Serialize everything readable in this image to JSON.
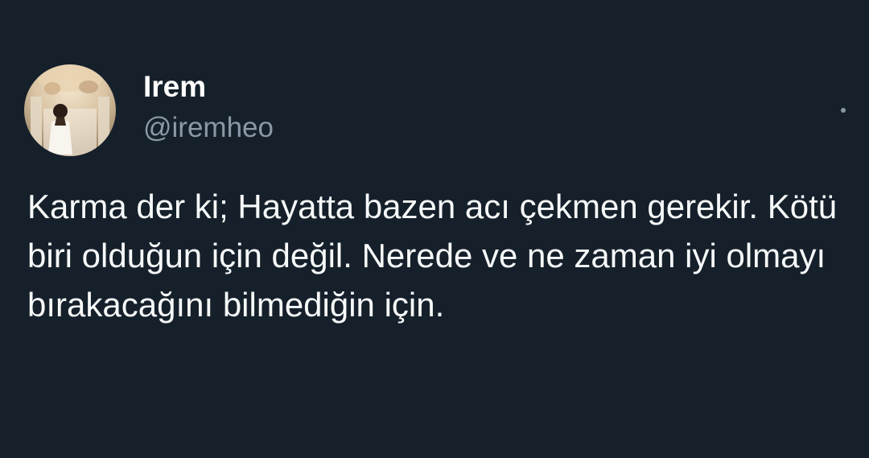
{
  "author": {
    "name": "Irem",
    "handle": "@iremheo",
    "avatar_icon": "profile-photo"
  },
  "menu": {
    "icon": "more-options-icon"
  },
  "tweet": {
    "text": "Karma der ki; Hayatta bazen acı çekmen gerekir. Kötü biri olduğun için değil. Nerede ve ne zaman iyi olmayı bırakacağını bilmediğin için."
  },
  "colors": {
    "background": "#15202b",
    "text_primary": "#ffffff",
    "text_secondary": "#8b98a5"
  }
}
